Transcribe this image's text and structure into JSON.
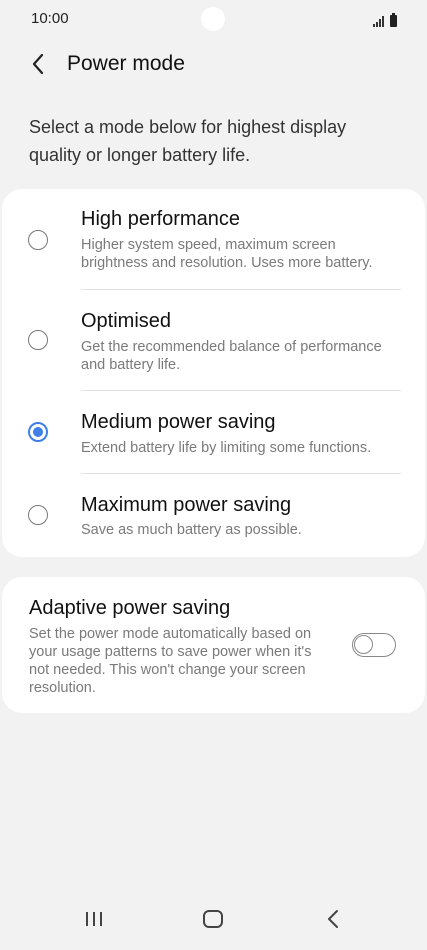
{
  "status_bar": {
    "time": "10:00",
    "icons": [
      "signal-icon",
      "battery-icon"
    ]
  },
  "header": {
    "back_icon": "chevron-left-icon",
    "title": "Power mode"
  },
  "description": "Select a mode below for highest display quality or longer battery life.",
  "modes": [
    {
      "title": "High performance",
      "subtitle": "Higher system speed, maximum screen brightness and resolution. Uses more battery.",
      "selected": false
    },
    {
      "title": "Optimised",
      "subtitle": "Get the recommended balance of performance and battery life.",
      "selected": false
    },
    {
      "title": "Medium power saving",
      "subtitle": "Extend battery life by limiting some functions.",
      "selected": true
    },
    {
      "title": "Maximum power saving",
      "subtitle": "Save as much battery as possible.",
      "selected": false
    }
  ],
  "adaptive": {
    "title": "Adaptive power saving",
    "subtitle": "Set the power mode automatically based on your usage patterns to save power when it's not needed. This won't change your screen resolution.",
    "enabled": false
  },
  "nav_bar": {
    "icons": [
      "recents-icon",
      "home-icon",
      "back-icon"
    ]
  },
  "colors": {
    "accent": "#3e80e6",
    "background": "#f2f2f2",
    "card": "#ffffff"
  }
}
